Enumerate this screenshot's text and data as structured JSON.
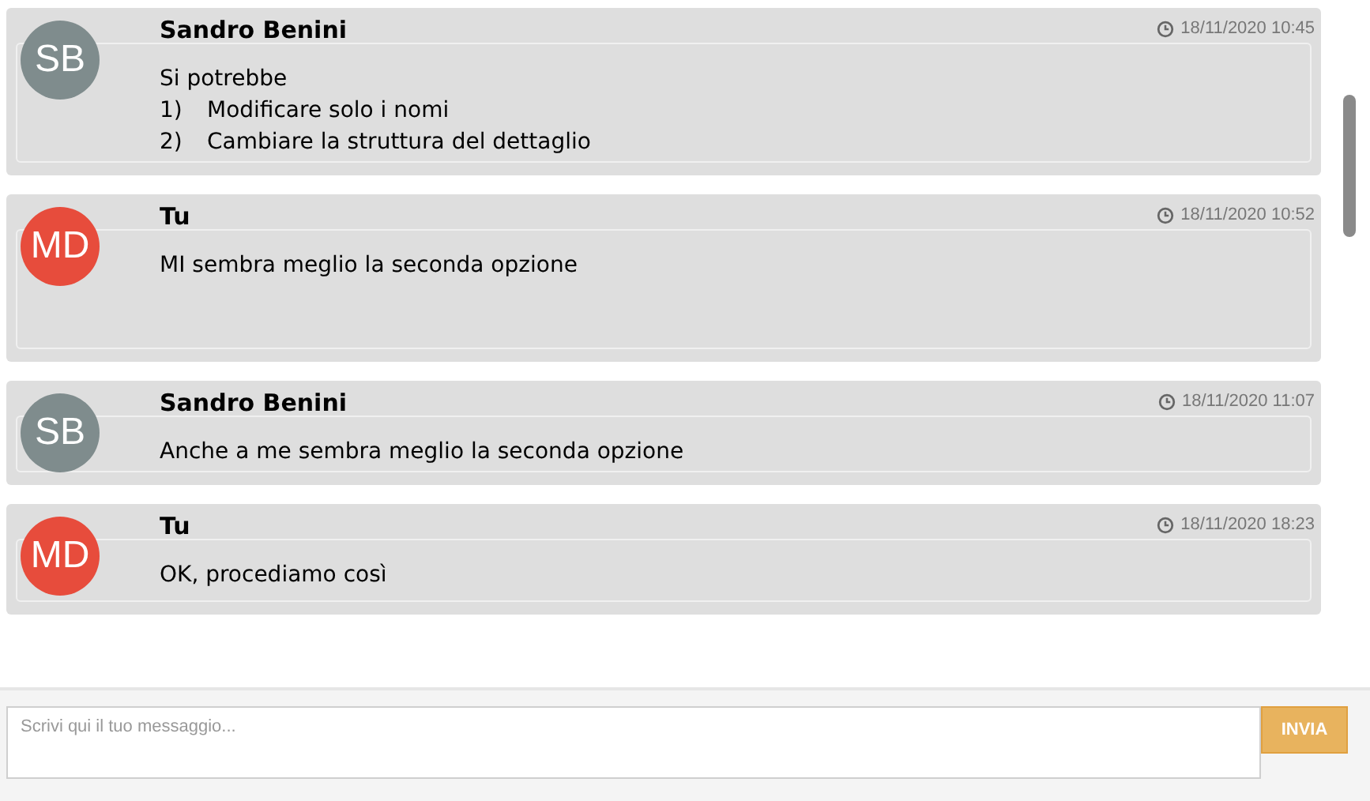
{
  "messages": [
    {
      "author": "Sandro Benini",
      "initials": "SB",
      "color": "#7f8c8d",
      "timestamp": "18/11/2020 10:45",
      "lines": [
        {
          "text": "Si potrebbe"
        },
        {
          "marker": "1)",
          "text": "Modificare solo i nomi"
        },
        {
          "marker": "2)",
          "text": "Cambiare la struttura del dettaglio"
        }
      ]
    },
    {
      "author": "Tu",
      "initials": "MD",
      "color": "#e74c3c",
      "timestamp": "18/11/2020 10:52",
      "lines": [
        {
          "text": "MI sembra meglio la seconda opzione"
        }
      ]
    },
    {
      "author": "Sandro Benini",
      "initials": "SB",
      "color": "#7f8c8d",
      "timestamp": "18/11/2020 11:07",
      "lines": [
        {
          "text": "Anche a me sembra meglio la seconda opzione"
        }
      ]
    },
    {
      "author": "Tu",
      "initials": "MD",
      "color": "#e74c3c",
      "timestamp": "18/11/2020 18:23",
      "lines": [
        {
          "text": "OK, procediamo così"
        }
      ]
    }
  ],
  "composer": {
    "placeholder": "Scrivi qui il tuo messaggio...",
    "send_label": "INVIA"
  }
}
